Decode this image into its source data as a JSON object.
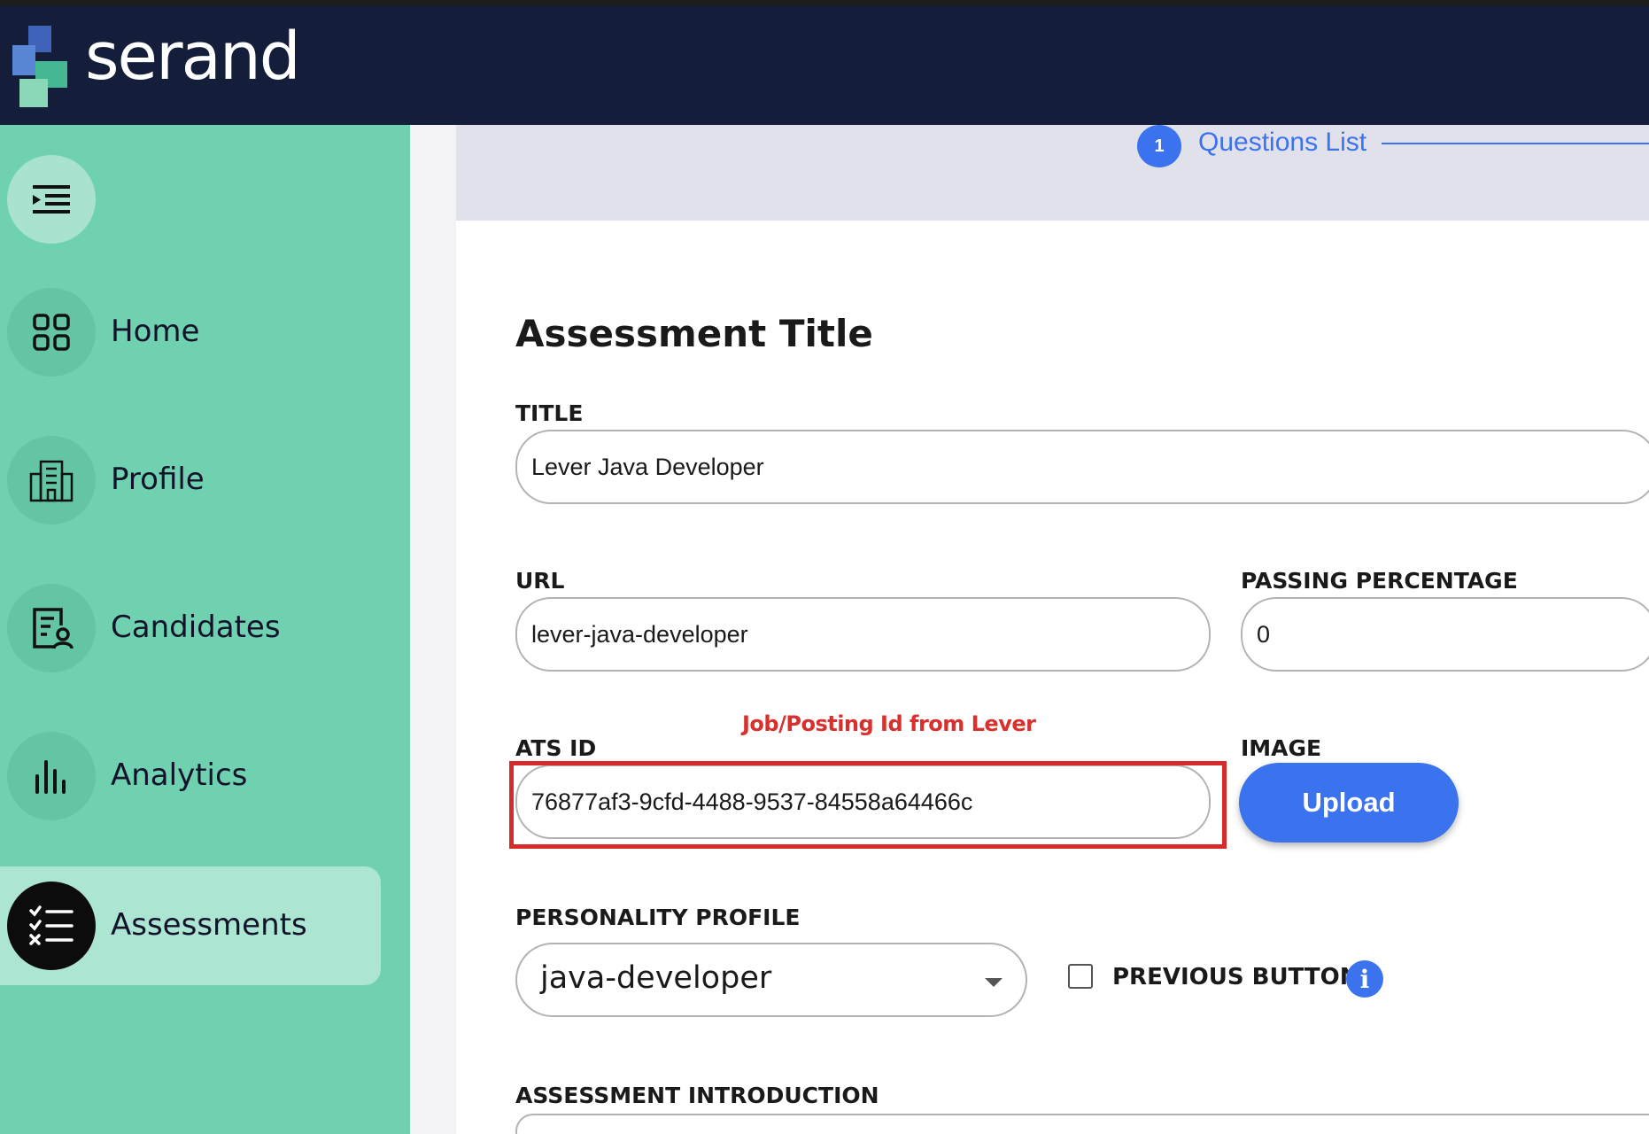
{
  "app": {
    "brand": "serand"
  },
  "sidebar": {
    "items": [
      {
        "label": "Home",
        "icon": "grid-icon"
      },
      {
        "label": "Profile",
        "icon": "building-icon"
      },
      {
        "label": "Candidates",
        "icon": "candidate-file-icon"
      },
      {
        "label": "Analytics",
        "icon": "bar-chart-icon"
      },
      {
        "label": "Assessments",
        "icon": "checklist-icon",
        "active": true
      }
    ]
  },
  "stepper": {
    "step_number": "1",
    "step_label": "Questions List"
  },
  "form": {
    "heading": "Assessment Title",
    "title_label": "TITLE",
    "title_value": "Lever Java Developer",
    "url_label": "URL",
    "url_value": "lever-java-developer",
    "passing_label": "PASSING PERCENTAGE",
    "passing_value": "0",
    "ats_label": "ATS ID",
    "ats_value": "76877af3-9cfd-4488-9537-84558a64466c",
    "ats_hint": "Job/Posting Id from Lever",
    "image_label": "IMAGE",
    "upload_label": "Upload",
    "personality_label": "PERSONALITY PROFILE",
    "personality_value": "java-developer",
    "previous_button_label": "PREVIOUS BUTTON",
    "previous_button_checked": false,
    "intro_label": "ASSESSMENT INTRODUCTION"
  },
  "colors": {
    "header_bg": "#141e3a",
    "sidebar_bg": "#6fd1b0",
    "accent": "#3b72ee",
    "hint_red": "#d9302d"
  }
}
